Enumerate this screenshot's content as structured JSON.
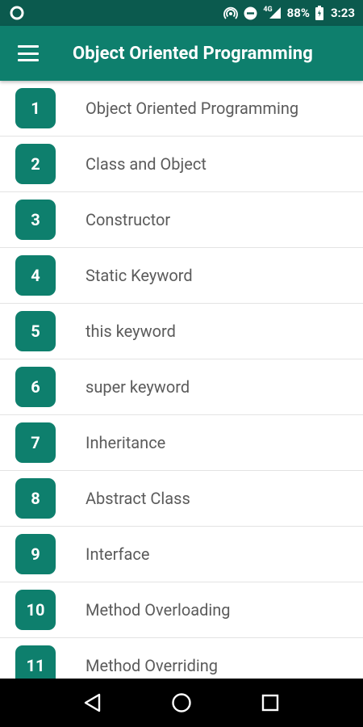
{
  "status_bar": {
    "network_type": "4G",
    "battery_percent": "88%",
    "time": "3:23",
    "icons": [
      "app-notification-icon",
      "hotspot-icon",
      "do-not-disturb-icon",
      "signal-icon",
      "battery-icon"
    ]
  },
  "app_bar": {
    "title": "Object Oriented Programming",
    "menu_icon": "hamburger-menu-icon"
  },
  "topics": [
    {
      "number": "1",
      "label": "Object Oriented Programming"
    },
    {
      "number": "2",
      "label": "Class and Object"
    },
    {
      "number": "3",
      "label": "Constructor"
    },
    {
      "number": "4",
      "label": "Static Keyword"
    },
    {
      "number": "5",
      "label": "this keyword"
    },
    {
      "number": "6",
      "label": "super keyword"
    },
    {
      "number": "7",
      "label": "Inheritance"
    },
    {
      "number": "8",
      "label": "Abstract Class"
    },
    {
      "number": "9",
      "label": "Interface"
    },
    {
      "number": "10",
      "label": "Method Overloading"
    },
    {
      "number": "11",
      "label": "Method Overriding"
    }
  ],
  "nav_bar": {
    "icons": [
      "back-icon",
      "home-icon",
      "recents-icon"
    ]
  },
  "colors": {
    "status_bar": "#0b5a4e",
    "primary": "#0e7f6d",
    "label_text": "#5b5b5b",
    "divider": "#e3e3e3"
  }
}
